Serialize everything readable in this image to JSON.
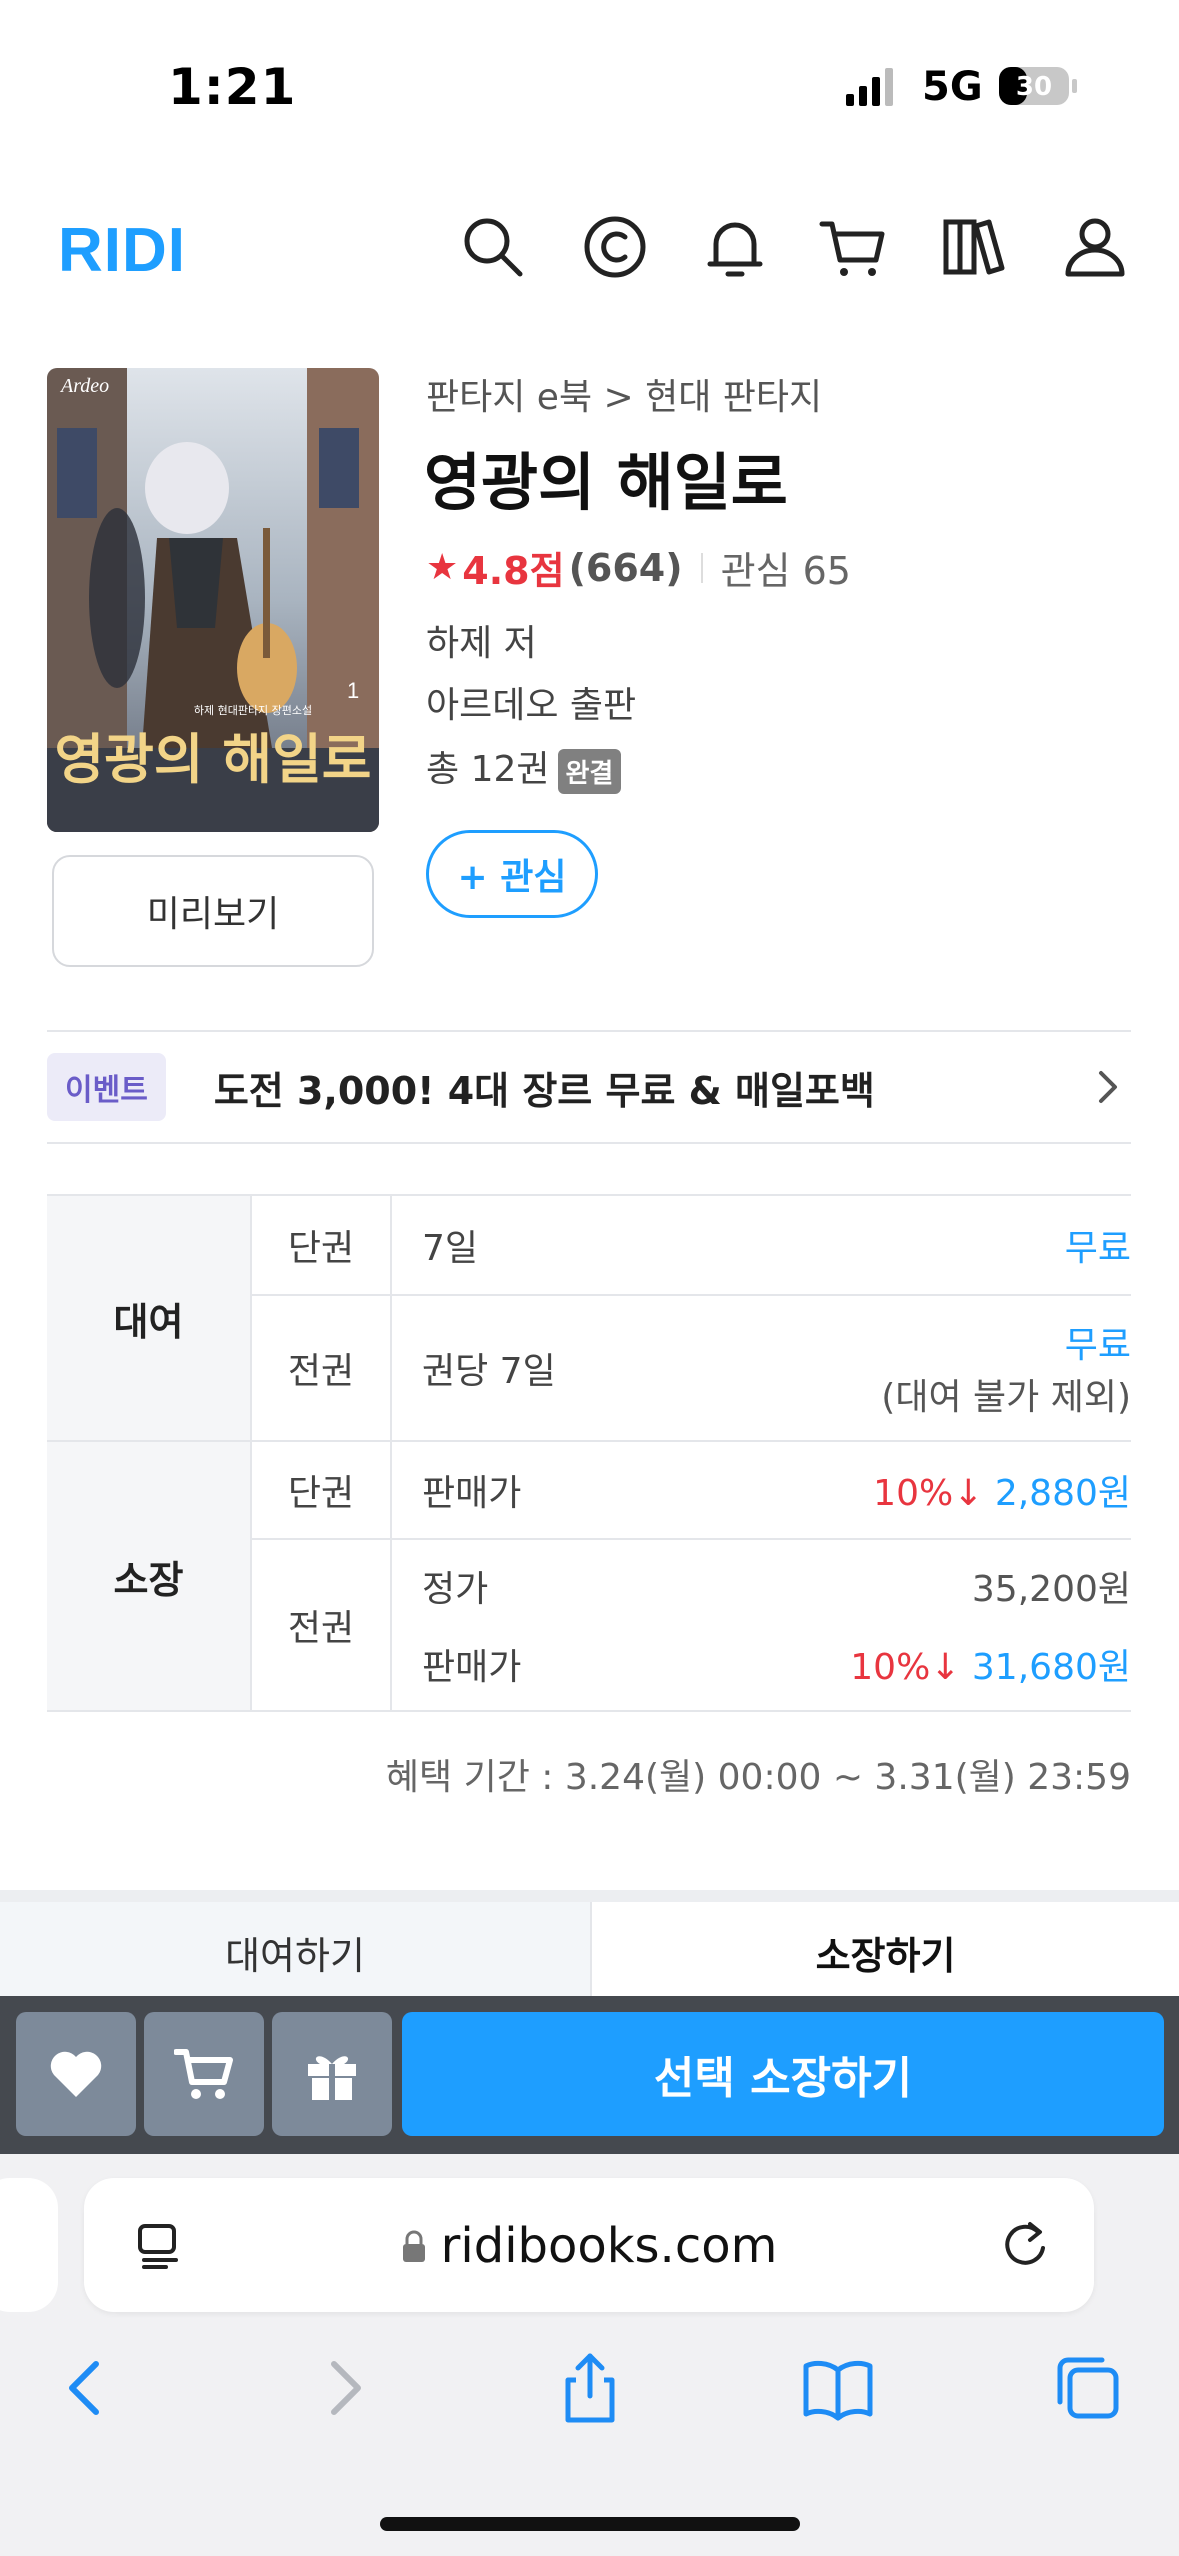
{
  "status": {
    "time": "1:21",
    "network": "5G",
    "battery": "30"
  },
  "header": {
    "logo": "RIDI",
    "icons": [
      "search-icon",
      "coin-icon",
      "bell-icon",
      "cart-icon",
      "library-icon",
      "user-icon"
    ]
  },
  "book": {
    "cover": {
      "publisher_mark": "Ardeo",
      "volume": "1",
      "title_art": "영광의 해일로",
      "credit": "하제 현대판타지 장편소설"
    },
    "breadcrumb": "판타지 e북 > 현대 판타지",
    "title": "영광의 해일로",
    "rating": "4.8점",
    "rating_count": "(664)",
    "interest": "관심 65",
    "author": "하제 저",
    "publisher": "아르데오 출판",
    "volumes": "총 12권",
    "complete_badge": "완결",
    "preview_label": "미리보기",
    "wish_label": "+ 관심"
  },
  "event": {
    "tag": "이벤트",
    "text": "도전 3,000! 4대 장르 무료 & 매일포백"
  },
  "pricing": {
    "rent": {
      "label": "대여",
      "single": {
        "type": "단권",
        "period": "7일",
        "price": "무료"
      },
      "all": {
        "type": "전권",
        "period": "권당 7일",
        "price": "무료",
        "note": "(대여 불가 제외)"
      }
    },
    "own": {
      "label": "소장",
      "single": {
        "type": "단권",
        "price_label": "판매가",
        "discount": "10%↓",
        "price": "2,880원"
      },
      "all": {
        "type": "전권",
        "list_label": "정가",
        "list_price": "35,200원",
        "price_label": "판매가",
        "discount": "10%↓",
        "price": "31,680원"
      }
    },
    "benefit_period": "혜택 기간 : 3.24(월) 00:00 ~ 3.31(월) 23:59"
  },
  "tabs": {
    "rent": "대여하기",
    "own": "소장하기"
  },
  "actions": {
    "buy_label": "선택 소장하기"
  },
  "browser": {
    "url": "ridibooks.com"
  },
  "colors": {
    "accent": "#1e9eff",
    "discount": "#e8353f",
    "action_bar": "#45494f"
  }
}
